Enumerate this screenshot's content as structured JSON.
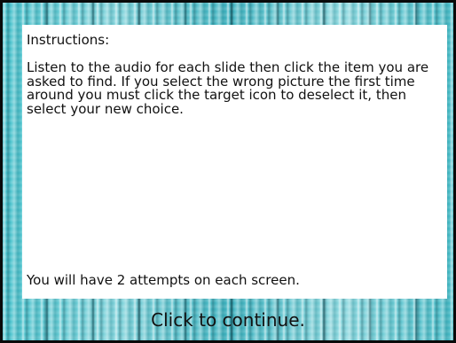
{
  "instructions": {
    "heading": "Instructions:",
    "body": "Listen to the audio for each slide then click the item you are asked to find. If you select the wrong picture the first time around you must click the target icon to deselect it, then select your new choice.",
    "attempts_note": "You will have 2 attempts on each screen."
  },
  "footer": {
    "continue_label": "Click to continue."
  },
  "colors": {
    "background": "#3fb8c4",
    "panel": "#ffffff",
    "border": "#0a0a0a",
    "text": "#111111"
  }
}
